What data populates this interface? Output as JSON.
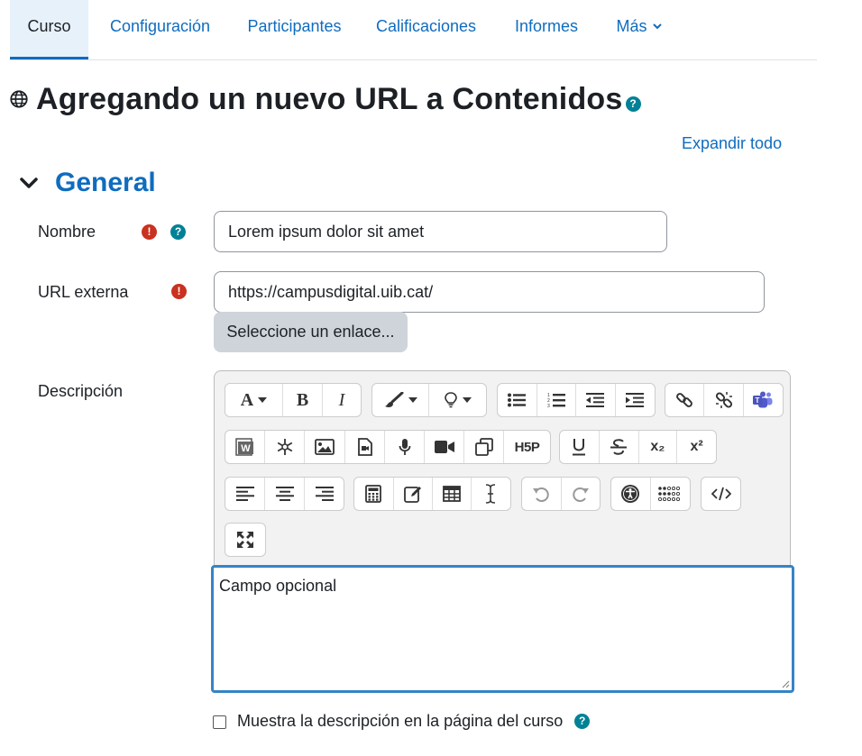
{
  "nav": {
    "tabs": [
      {
        "label": "Curso"
      },
      {
        "label": "Configuración"
      },
      {
        "label": "Participantes"
      },
      {
        "label": "Calificaciones"
      },
      {
        "label": "Informes"
      },
      {
        "label": "Más"
      }
    ],
    "active_tab": "Curso"
  },
  "page": {
    "title": "Agregando un nuevo URL a Contenidos",
    "help_glyph": "?",
    "expand_all": "Expandir todo"
  },
  "section": {
    "title": "General"
  },
  "form": {
    "name": {
      "label": "Nombre",
      "value": "Lorem ipsum dolor sit amet",
      "required_glyph": "!",
      "help_glyph": "?"
    },
    "url": {
      "label": "URL externa",
      "value": "https://campusdigital.uib.cat/",
      "required_glyph": "!",
      "choose_button": "Seleccione un enlace..."
    },
    "description": {
      "label": "Descripción",
      "placeholder": "Campo opcional",
      "toolbar": {
        "font_glyph": "A",
        "bold_glyph": "B",
        "italic_glyph": "I",
        "h5p_glyph": "H5P",
        "subscript_glyph": "x₂",
        "superscript_glyph": "x²"
      }
    },
    "show_description": {
      "label": "Muestra la descripción en la página del curso",
      "checked": false,
      "help_glyph": "?"
    }
  },
  "colors": {
    "brand_blue": "#0f6cbf",
    "text": "#1d2125",
    "required_red": "#ca3120",
    "help_teal": "#008196",
    "active_tab_bg": "#e7f1fa",
    "editor_focus": "#3584c5"
  }
}
